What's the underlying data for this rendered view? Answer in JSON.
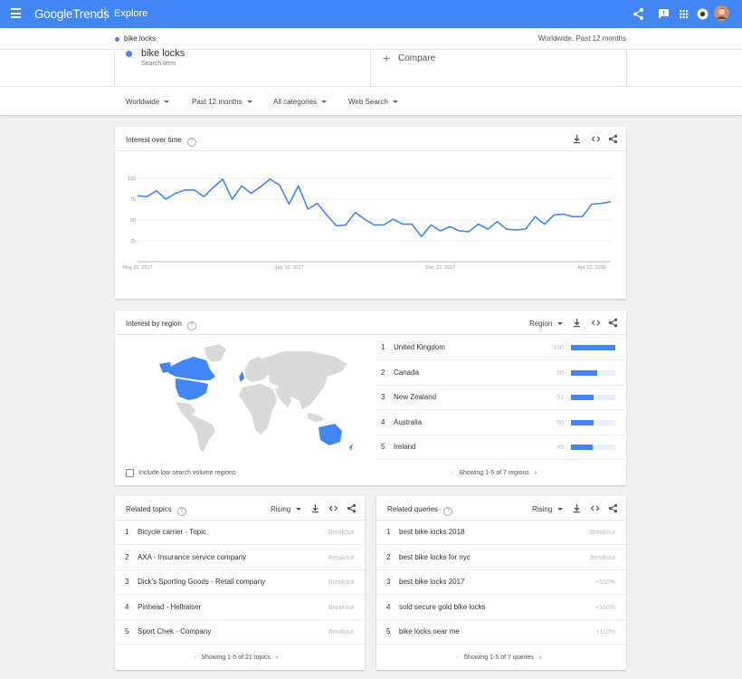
{
  "app": {
    "logo_prefix": "Google",
    "logo_suffix": "Trends",
    "section": "Explore"
  },
  "term_strip": {
    "term": "bike locks",
    "scope": "Worldwide, Past 12 months"
  },
  "search_term": {
    "name": "bike locks",
    "sub": "Search term",
    "compare_label": "Compare",
    "plus": "+"
  },
  "filters": [
    "Worldwide",
    "Past 12 months",
    "All categories",
    "Web Search"
  ],
  "interest_over_time": {
    "title": "Interest over time",
    "help": "?"
  },
  "chart_data": {
    "type": "line",
    "title": "Interest over time",
    "xlabel": "",
    "ylabel": "",
    "ylim": [
      0,
      100
    ],
    "yticks": [
      25,
      50,
      75,
      100
    ],
    "grid": true,
    "x_tick_labels": [
      {
        "label": "May 21, 2017",
        "week": 0
      },
      {
        "label": "Sep 10, 2017",
        "week": 16
      },
      {
        "label": "Dec 31, 2017",
        "week": 32
      },
      {
        "label": "Apr 22, 2018",
        "week": 48
      }
    ],
    "series": [
      {
        "color": "#4285f4",
        "values": [
          79,
          78,
          85,
          75,
          82,
          86,
          86,
          78,
          89,
          99,
          75,
          91,
          82,
          90,
          99,
          92,
          69,
          91,
          63,
          70,
          56,
          43,
          44,
          59,
          51,
          44,
          44,
          51,
          45,
          45,
          30,
          44,
          37,
          42,
          37,
          36,
          45,
          39,
          48,
          39,
          38,
          39,
          54,
          45,
          56,
          57,
          54,
          54,
          69,
          70,
          72
        ]
      }
    ]
  },
  "interest_by_region": {
    "title": "Interest by region",
    "help": "?",
    "dropdown": "Region",
    "rows": [
      {
        "rank": "1",
        "name": "United Kingdom",
        "value": 100
      },
      {
        "rank": "2",
        "name": "Canada",
        "value": 60
      },
      {
        "rank": "3",
        "name": "New Zealand",
        "value": 51
      },
      {
        "rank": "4",
        "name": "Australia",
        "value": 50
      },
      {
        "rank": "5",
        "name": "Ireland",
        "value": 49
      }
    ],
    "checkbox_label": "Include low search volume regions",
    "pager": "Showing 1-5 of 7 regions",
    "map_colors": {
      "land": "#d9d9d9",
      "highlight": "#4285f4"
    }
  },
  "related_topics": {
    "title": "Related topics",
    "help": "?",
    "dropdown": "Rising",
    "rows": [
      {
        "rank": "1",
        "name": "Bicycle carrier - Topic",
        "value": "Breakout"
      },
      {
        "rank": "2",
        "name": "AXA - Insurance service company",
        "value": "Breakout"
      },
      {
        "rank": "3",
        "name": "Dick's Sporting Goods - Retail company",
        "value": "Breakout"
      },
      {
        "rank": "4",
        "name": "Pinhead - Hellraiser",
        "value": "Breakout"
      },
      {
        "rank": "5",
        "name": "Sport Chek - Company",
        "value": "Breakout"
      }
    ],
    "pager": "Showing 1-5 of 21 topics"
  },
  "related_queries": {
    "title": "Related queries",
    "help": "?",
    "dropdown": "Rising",
    "rows": [
      {
        "rank": "1",
        "name": "best bike locks 2018",
        "value": "Breakout"
      },
      {
        "rank": "2",
        "name": "best bike locks for nyc",
        "value": "Breakout"
      },
      {
        "rank": "3",
        "name": "best bike locks 2017",
        "value": "+550%"
      },
      {
        "rank": "4",
        "name": "sold secure gold bike locks",
        "value": "+160%"
      },
      {
        "rank": "5",
        "name": "bike locks near me",
        "value": "+110%"
      }
    ],
    "pager": "Showing 1-5 of 7 queries"
  },
  "icons": {
    "menu": "menu-icon",
    "share": "share-icon",
    "feedback": "feedback-icon",
    "apps": "apps-icon",
    "account": "account-icon",
    "avatar": "avatar",
    "download": "download-icon",
    "embed": "embed-icon",
    "help": "help-icon",
    "chevron_left": "chevron-left-icon",
    "chevron_right": "chevron-right-icon"
  },
  "colors": {
    "accent": "#4285f4",
    "background": "#f1f1f1"
  }
}
